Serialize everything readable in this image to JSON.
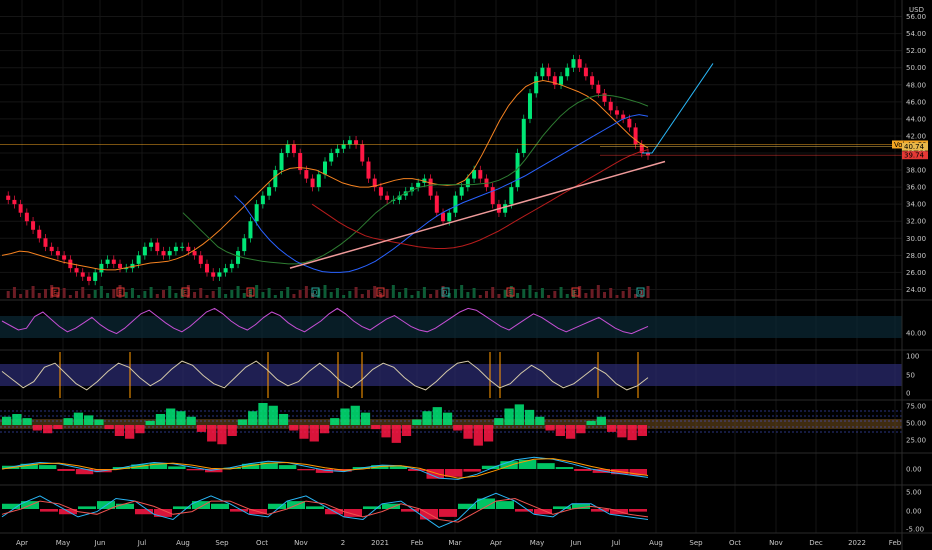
{
  "currency": "USD",
  "chart_data": [
    {
      "type": "line",
      "panel": "price",
      "ylim": [
        23,
        57
      ],
      "y_ticks": [
        "56.00",
        "54.00",
        "52.00",
        "50.00",
        "48.00",
        "46.00",
        "44.00",
        "42.00",
        "40.00",
        "38.00",
        "36.00",
        "34.00",
        "32.00",
        "30.00",
        "28.00",
        "26.00",
        "24.00"
      ],
      "x_ticks": [
        "Apr",
        "May",
        "Jun",
        "Jul",
        "Aug",
        "Sep",
        "Oct",
        "Nov",
        "2",
        "2021",
        "Feb",
        "Mar",
        "Apr",
        "May",
        "Jun",
        "Jul",
        "Aug",
        "Sep",
        "Oct",
        "Nov",
        "Dec",
        "2022",
        "Feb"
      ],
      "price_labels": [
        {
          "text": "Vol  40.59",
          "value": 41.0,
          "color": "#f5a623"
        },
        {
          "text": "40.74",
          "value": 40.74,
          "color": "#e8b84b"
        },
        {
          "text": "39.74",
          "value": 39.74,
          "color": "#e53935"
        }
      ],
      "close": [
        35,
        34.5,
        34,
        33,
        32,
        31,
        30,
        29,
        28.5,
        28,
        27.5,
        26.5,
        26,
        25.5,
        25,
        26,
        27,
        27.5,
        27,
        26.5,
        26.5,
        27,
        28,
        29,
        29.5,
        28.5,
        28,
        28.5,
        29,
        29,
        28.5,
        28,
        27,
        26,
        25.5,
        26,
        26.5,
        27,
        28.5,
        30,
        32,
        34,
        35,
        36,
        38,
        40,
        41,
        40,
        38,
        37,
        36,
        37.5,
        39,
        40,
        40.5,
        41,
        41.5,
        41,
        39,
        37,
        36,
        35,
        34.5,
        34.5,
        35,
        35.5,
        36,
        36.5,
        37,
        35,
        33,
        32,
        33,
        35,
        36,
        37,
        38,
        37,
        36,
        34,
        33,
        34,
        36,
        40,
        44,
        47,
        49,
        50,
        49,
        48,
        49,
        50,
        51,
        50,
        49,
        48,
        47,
        46,
        45,
        44.5,
        44,
        43,
        41,
        40,
        39.7
      ],
      "series": [
        {
          "name": "",
          "color": "#f58220",
          "values": [
            28,
            28.2,
            28.5,
            28.4,
            28.1,
            27.8,
            27.5,
            27.2,
            27,
            26.8,
            26.6,
            26.4,
            26.3,
            26.3,
            26.5,
            26.7,
            26.9,
            27.1,
            27.2,
            27.3,
            27.6,
            28,
            28.6,
            29.3,
            30.1,
            31,
            32,
            33,
            34,
            35,
            36,
            37,
            37.8,
            38.2,
            38.3,
            38.2,
            38,
            37.5,
            37,
            36.5,
            36.2,
            36,
            36,
            36.2,
            36.5,
            36.8,
            37,
            37,
            36.8,
            36.5,
            36.3,
            36.2,
            36.3,
            36.8,
            38,
            39.8,
            41.8,
            43.8,
            45.5,
            46.8,
            47.8,
            48.3,
            48.5,
            48.3,
            48,
            47.6,
            47.2,
            46.7,
            46,
            45,
            44,
            43,
            42,
            41.2,
            40.6
          ]
        },
        {
          "name": "",
          "color": "#2e7d32",
          "values": [
            33,
            32,
            31,
            30,
            29,
            28.4,
            28,
            27.7,
            27.5,
            27.3,
            27.2,
            27.1,
            27,
            27,
            27.2,
            27.5,
            28,
            28.6,
            29.3,
            30.1,
            31,
            32,
            33,
            33.8,
            34.5,
            35.1,
            35.6,
            36,
            36.2,
            36.3,
            36.3,
            36.3,
            36.3,
            36.3,
            36.4,
            36.5,
            36.8,
            37.3,
            38,
            39.2,
            40.6,
            42,
            43.2,
            44.3,
            45.2,
            45.9,
            46.4,
            46.7,
            46.8,
            46.7,
            46.5,
            46.2,
            45.9,
            45.5
          ]
        },
        {
          "name": "",
          "color": "#2962ff",
          "values": [
            35,
            34,
            32.5,
            31,
            29.8,
            28.8,
            28,
            27.3,
            26.8,
            26.4,
            26.1,
            26,
            26,
            26.1,
            26.4,
            26.8,
            27.3,
            28,
            28.7,
            29.5,
            30.3,
            31.1,
            31.9,
            32.6,
            33.2,
            33.7,
            34.2,
            34.6,
            35,
            35.4,
            35.8,
            36.3,
            36.8,
            37.3,
            37.9,
            38.5,
            39.1,
            39.7,
            40.3,
            40.9,
            41.5,
            42.1,
            42.7,
            43.3,
            43.9,
            44.3,
            44.5,
            44.3
          ]
        },
        {
          "name": "",
          "color": "#b71c1c",
          "values": [
            34,
            33.3,
            32.6,
            31.9,
            31.3,
            30.8,
            30.3,
            30,
            29.8,
            29.6,
            29.4,
            29.2,
            29,
            28.9,
            28.8,
            28.8,
            28.9,
            29.1,
            29.4,
            29.8,
            30.3,
            30.8,
            31.4,
            32,
            32.6,
            33.2,
            33.8,
            34.4,
            35,
            35.6,
            36.2,
            36.8,
            37.4,
            38,
            38.6,
            39.2,
            39.7,
            40.1,
            40.4
          ]
        }
      ],
      "trendlines": [
        {
          "name": "",
          "color": "#ef9a9a",
          "points": [
            [
              "Oct",
              26.5
            ],
            [
              "Aug",
              39.0
            ]
          ]
        },
        {
          "name": "",
          "color": "#29b6f6",
          "points": [
            [
              "Jul",
              40.0
            ],
            [
              "Aug",
              50.5
            ]
          ]
        }
      ],
      "markers": [
        "E",
        "E",
        "E",
        "E",
        "D",
        "E",
        "D",
        "E",
        "E",
        "D"
      ]
    },
    {
      "type": "line",
      "panel": "rsi",
      "y_ticks": [
        "40.00"
      ],
      "series": [
        {
          "name": "",
          "color": "#c54fd4",
          "values": [
            50,
            45,
            40,
            42,
            55,
            60,
            52,
            44,
            38,
            42,
            48,
            54,
            46,
            40,
            36,
            42,
            50,
            58,
            62,
            55,
            48,
            42,
            38,
            44,
            52,
            60,
            64,
            58,
            50,
            44,
            40,
            46,
            54,
            60,
            56,
            48,
            42,
            38,
            44,
            50,
            58,
            64,
            58,
            50,
            44,
            40,
            46,
            52,
            56,
            50,
            44,
            40,
            38,
            42,
            48,
            54,
            60,
            64,
            62,
            56,
            50,
            44,
            40,
            46,
            52,
            58,
            54,
            48,
            42,
            38,
            42,
            46,
            50,
            54,
            48,
            42,
            38,
            36,
            40,
            44
          ]
        }
      ]
    },
    {
      "type": "line",
      "panel": "stochastic",
      "y_ticks": [
        "100",
        "50",
        "0"
      ],
      "series": [
        {
          "name": "",
          "color": "#d4c9a8",
          "values": [
            60,
            40,
            20,
            35,
            70,
            80,
            55,
            30,
            15,
            35,
            60,
            80,
            70,
            45,
            25,
            40,
            65,
            85,
            75,
            50,
            30,
            20,
            45,
            70,
            85,
            65,
            40,
            25,
            35,
            60,
            80,
            60,
            35,
            20,
            40,
            65,
            80,
            70,
            45,
            25,
            15,
            35,
            60,
            80,
            85,
            65,
            40,
            20,
            30,
            55,
            75,
            60,
            35,
            20,
            30,
            50,
            70,
            55,
            30,
            15,
            25,
            45
          ]
        }
      ]
    },
    {
      "type": "bar",
      "panel": "momentum-histogram",
      "y_ticks": [
        "75.00",
        "50.00",
        "25.00"
      ],
      "values": [
        6,
        8,
        5,
        -4,
        -6,
        -3,
        5,
        9,
        7,
        4,
        -3,
        -8,
        -10,
        -6,
        3,
        8,
        12,
        10,
        6,
        -5,
        -12,
        -14,
        -8,
        4,
        10,
        16,
        14,
        8,
        -4,
        -10,
        -12,
        -6,
        5,
        12,
        14,
        9,
        -3,
        -9,
        -13,
        -8,
        4,
        10,
        13,
        9,
        -4,
        -10,
        -15,
        -12,
        5,
        12,
        15,
        11,
        6,
        -4,
        -8,
        -10,
        -6,
        3,
        6,
        -5,
        -9,
        -11,
        -8
      ]
    },
    {
      "type": "bar",
      "panel": "macd",
      "y_ticks": [
        "0.00"
      ],
      "values": [
        0.5,
        0.8,
        0.6,
        -0.3,
        -0.8,
        -0.5,
        0.3,
        0.7,
        0.9,
        0.4,
        -0.2,
        -0.5,
        0.2,
        0.8,
        1.0,
        0.6,
        -0.2,
        -0.6,
        -0.4,
        0.3,
        0.6,
        0.4,
        -0.3,
        -1.5,
        -1.2,
        -0.4,
        0.5,
        1.2,
        1.4,
        0.9,
        0.3,
        -0.3,
        -0.6,
        -0.8,
        -1.0
      ],
      "series": [
        {
          "name": "",
          "color": "#29b6f6",
          "values": [
            0,
            0.6,
            1.0,
            0.8,
            0.2,
            -0.4,
            0.0,
            0.6,
            1.0,
            0.8,
            0.3,
            -0.2,
            0.2,
            0.8,
            1.2,
            1.0,
            0.4,
            -0.2,
            -0.4,
            0.2,
            0.6,
            0.5,
            -0.2,
            -1.4,
            -1.6,
            -0.8,
            0.4,
            1.4,
            1.8,
            1.5,
            0.8,
            0.0,
            -0.5,
            -0.9,
            -1.3
          ]
        },
        {
          "name": "",
          "color": "#ff9800",
          "values": [
            0,
            0.4,
            0.8,
            0.9,
            0.5,
            -0.1,
            -0.1,
            0.3,
            0.7,
            0.9,
            0.6,
            0.1,
            0.0,
            0.5,
            0.9,
            1.0,
            0.7,
            0.2,
            -0.2,
            0.0,
            0.4,
            0.5,
            0.1,
            -0.8,
            -1.4,
            -1.1,
            -0.2,
            0.8,
            1.5,
            1.6,
            1.1,
            0.4,
            -0.2,
            -0.6,
            -1.0
          ]
        }
      ]
    },
    {
      "type": "bar",
      "panel": "oscillator",
      "y_ticks": [
        "5.00",
        "0.00",
        "-5.00"
      ],
      "values": [
        2,
        3,
        -1,
        -2,
        1,
        3,
        2,
        -2,
        -3,
        1,
        3,
        2,
        -1,
        -2,
        2,
        3,
        1,
        -2,
        -3,
        1,
        2,
        -1,
        -4,
        -3,
        2,
        4,
        3,
        -1,
        -2,
        1,
        2,
        -1,
        -2,
        -1
      ],
      "series": [
        {
          "name": "",
          "color": "#29b6f6",
          "values": [
            -3,
            2,
            5,
            1,
            -3,
            -1,
            4,
            3,
            -2,
            -4,
            2,
            5,
            2,
            -2,
            -3,
            3,
            5,
            1,
            -3,
            -4,
            2,
            3,
            -2,
            -7,
            -4,
            3,
            6,
            3,
            -2,
            -3,
            2,
            2,
            -2,
            -3,
            -4
          ]
        },
        {
          "name": "",
          "color": "#ef5350",
          "values": [
            -2,
            0,
            3,
            2,
            -1,
            -2,
            1,
            3,
            1,
            -2,
            -1,
            3,
            3,
            0,
            -2,
            0,
            3,
            2,
            -1,
            -3,
            -1,
            2,
            0,
            -4,
            -5,
            -1,
            3,
            4,
            1,
            -2,
            0,
            1,
            0,
            -2,
            -3
          ]
        }
      ]
    }
  ],
  "colors": {
    "up": "#00e676",
    "down": "#ff1744",
    "grid": "#151515"
  }
}
